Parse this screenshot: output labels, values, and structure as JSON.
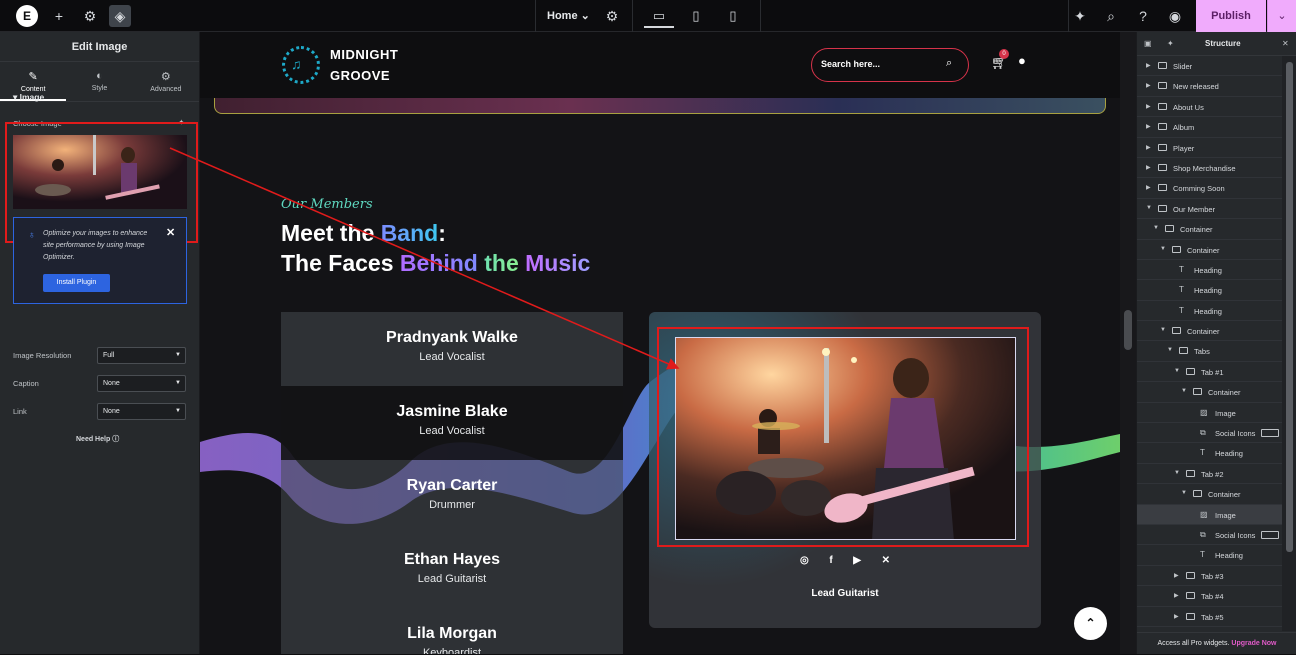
{
  "topbar": {
    "page": "Home",
    "publish": "Publish"
  },
  "left_panel": {
    "title": "Edit Image",
    "tabs": [
      {
        "label": "Content",
        "icon": "pencil-icon"
      },
      {
        "label": "Style",
        "icon": "contrast-icon"
      },
      {
        "label": "Advanced",
        "icon": "gear-icon"
      }
    ],
    "section": "Image",
    "choose_image": "Choose Image",
    "notice": "Optimize your images to enhance site performance by using Image Optimizer.",
    "install_button": "Install Plugin",
    "controls": [
      {
        "label": "Image Resolution",
        "value": "Full"
      },
      {
        "label": "Caption",
        "value": "None"
      },
      {
        "label": "Link",
        "value": "None"
      }
    ],
    "need_help": "Need Help"
  },
  "site": {
    "logo_line1": "MIDNIGHT",
    "logo_line2": "GROOVE",
    "search_placeholder": "Search here...",
    "cart_count": "0",
    "eyebrow": "Our Members",
    "headline": {
      "l1a": "Meet the ",
      "l1b": "Band",
      ":": ":",
      "l2a": "The Faces ",
      "l2b": "Behind ",
      "l2c": "the ",
      "l2d": "Music"
    },
    "members": [
      {
        "name": "Pradnyank Walke",
        "role": "Lead Vocalist"
      },
      {
        "name": "Jasmine Blake",
        "role": "Lead Vocalist"
      },
      {
        "name": "Ryan Carter",
        "role": "Drummer"
      },
      {
        "name": "Ethan Hayes",
        "role": "Lead Guitarist"
      },
      {
        "name": "Lila Morgan",
        "role": "Keyboardist"
      }
    ],
    "card_role": "Lead Guitarist",
    "socials": [
      "instagram-icon",
      "facebook-icon",
      "youtube-icon",
      "x-icon"
    ]
  },
  "structure": {
    "title": "Structure",
    "rows": [
      {
        "label": "Slider",
        "level": 0,
        "arrow": "right",
        "icon": "folder"
      },
      {
        "label": "New released",
        "level": 0,
        "arrow": "right",
        "icon": "folder"
      },
      {
        "label": "About Us",
        "level": 0,
        "arrow": "right",
        "icon": "folder"
      },
      {
        "label": "Album",
        "level": 0,
        "arrow": "right",
        "icon": "folder"
      },
      {
        "label": "Player",
        "level": 0,
        "arrow": "right",
        "icon": "folder"
      },
      {
        "label": "Shop Merchandise",
        "level": 0,
        "arrow": "right",
        "icon": "folder"
      },
      {
        "label": "Comming Soon",
        "level": 0,
        "arrow": "right",
        "icon": "folder"
      },
      {
        "label": "Our Member",
        "level": 0,
        "arrow": "down",
        "icon": "folder"
      },
      {
        "label": "Container",
        "level": 1,
        "arrow": "down",
        "icon": "folder"
      },
      {
        "label": "Container",
        "level": 2,
        "arrow": "down",
        "icon": "folder"
      },
      {
        "label": "Heading",
        "level": 3,
        "arrow": "",
        "icon": "heading"
      },
      {
        "label": "Heading",
        "level": 3,
        "arrow": "",
        "icon": "heading"
      },
      {
        "label": "Heading",
        "level": 3,
        "arrow": "",
        "icon": "heading"
      },
      {
        "label": "Container",
        "level": 2,
        "arrow": "down",
        "icon": "folder"
      },
      {
        "label": "Tabs",
        "level": 3,
        "arrow": "down",
        "icon": "folder"
      },
      {
        "label": "Tab #1",
        "level": 4,
        "arrow": "down",
        "icon": "folder"
      },
      {
        "label": "Container",
        "level": 5,
        "arrow": "down",
        "icon": "folder"
      },
      {
        "label": "Image",
        "level": 6,
        "arrow": "",
        "icon": "image"
      },
      {
        "label": "Social Icons",
        "level": 6,
        "arrow": "",
        "icon": "social",
        "eye": true
      },
      {
        "label": "Heading",
        "level": 6,
        "arrow": "",
        "icon": "heading"
      },
      {
        "label": "Tab #2",
        "level": 4,
        "arrow": "down",
        "icon": "folder"
      },
      {
        "label": "Container",
        "level": 5,
        "arrow": "down",
        "icon": "folder"
      },
      {
        "label": "Image",
        "level": 6,
        "arrow": "",
        "icon": "image",
        "selected": true
      },
      {
        "label": "Social Icons",
        "level": 6,
        "arrow": "",
        "icon": "social",
        "eye": true
      },
      {
        "label": "Heading",
        "level": 6,
        "arrow": "",
        "icon": "heading"
      },
      {
        "label": "Tab #3",
        "level": 4,
        "arrow": "right",
        "icon": "folder"
      },
      {
        "label": "Tab #4",
        "level": 4,
        "arrow": "right",
        "icon": "folder"
      },
      {
        "label": "Tab #5",
        "level": 4,
        "arrow": "right",
        "icon": "folder"
      }
    ],
    "footer_text": "Access all Pro widgets. ",
    "footer_link": "Upgrade Now"
  }
}
